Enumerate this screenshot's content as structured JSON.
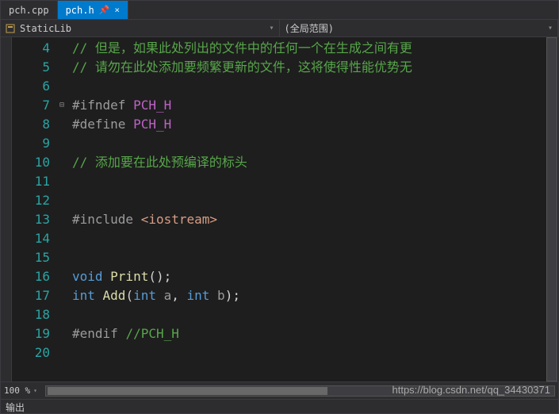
{
  "tabs": {
    "inactive": "pch.cpp",
    "active": "pch.h",
    "pin_glyph": "�günü",
    "close_glyph": "×"
  },
  "nav": {
    "left": "StaticLib",
    "right": "(全局范围)"
  },
  "gutter": {
    "start": 4,
    "end": 20
  },
  "fold": {
    "line": 7,
    "glyph": "⊟"
  },
  "code": {
    "l4_a": "// 但是，如果此处列出的文件中的任何一个在生成之间有更",
    "l5_a": "// 请勿在此处添加要频繁更新的文件，这将使得性能优势无",
    "l7_pp": "#ifndef",
    "l7_id": " PCH_H",
    "l8_pp": "#define",
    "l8_id": " PCH_H",
    "l10_a": "// 添加要在此处预编译的标头",
    "l13_pp": "#include ",
    "l13_inc": "<iostream>",
    "l16_kw": "void",
    "l16_fn": " Print",
    "l16_rest": "();",
    "l17_kw": "int",
    "l17_fn": " Add",
    "l17_open": "(",
    "l17_t1": "int",
    "l17_p1": " a",
    "l17_comma": ", ",
    "l17_t2": "int",
    "l17_p2": " b",
    "l17_close": ");",
    "l19_pp": "#endif ",
    "l19_cm": "//PCH_H"
  },
  "zoom": {
    "value": "100 %"
  },
  "output": {
    "label": "输出"
  },
  "watermark": "https://blog.csdn.net/qq_34430371"
}
